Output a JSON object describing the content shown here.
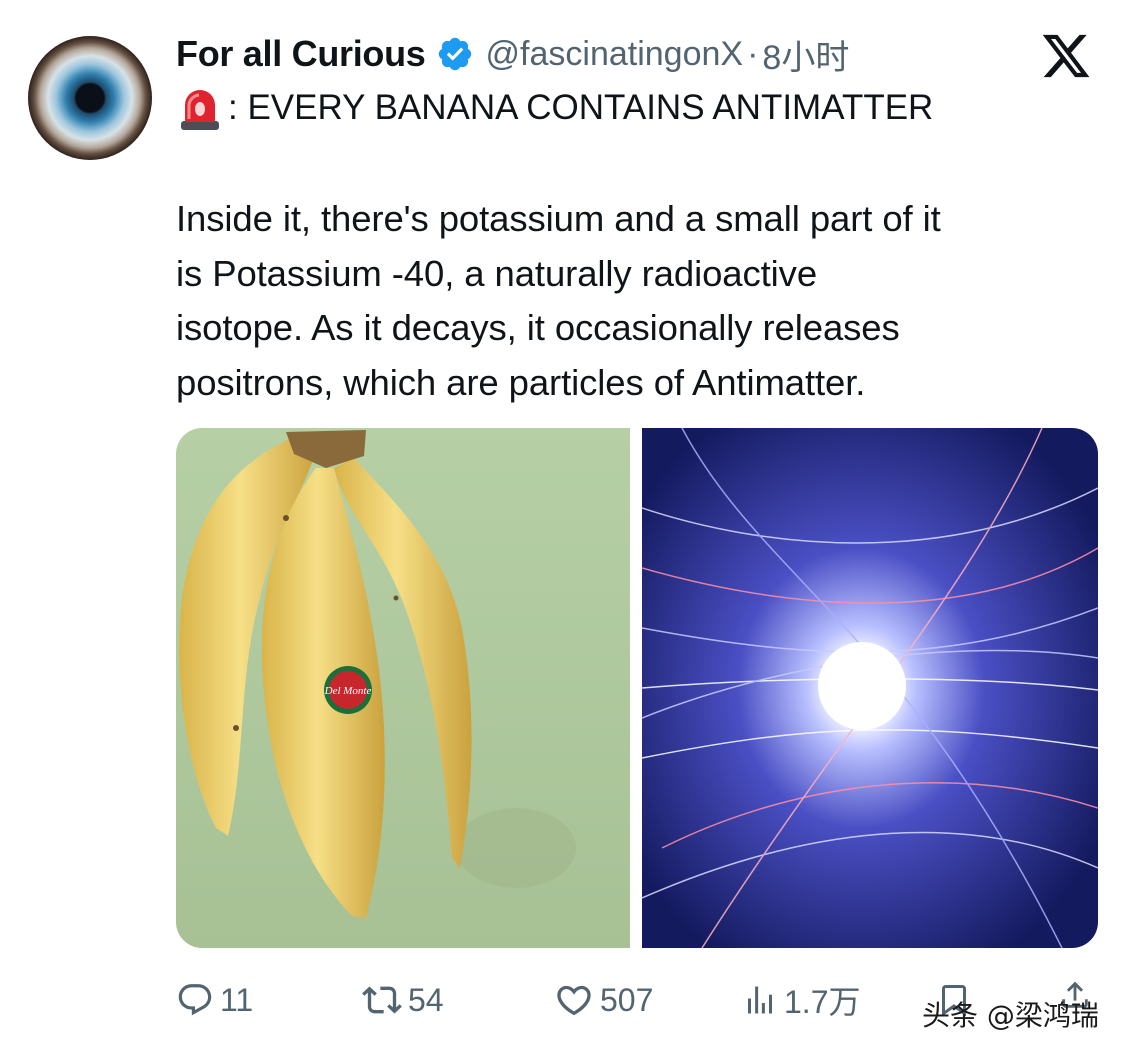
{
  "tweet": {
    "author_name": "For all Curious",
    "handle": "@fascinatingonX",
    "separator": "·",
    "time": "8小时",
    "headline": ": EVERY BANANA CONTAINS ANTIMATTER",
    "body": "Inside it, there's potassium and a small part of it\nis Potassium -40, a naturally radioactive\nisotope. As it decays, it occasionally releases\npositrons, which are particles of Antimatter.",
    "banana_sticker_text": "Del Monte"
  },
  "icons": {
    "avatar": "eye-avatar",
    "verified": "verified-badge-icon",
    "brand": "x-logo-icon",
    "siren": "siren-emoji-icon",
    "reply": "reply-icon",
    "retweet": "retweet-icon",
    "like": "like-icon",
    "views": "views-icon",
    "bookmark": "bookmark-icon",
    "share": "share-icon"
  },
  "actions": {
    "replies": "11",
    "retweets": "54",
    "likes": "507",
    "views": "1.7万"
  },
  "watermark": "头条 @梁鸿瑞",
  "colors": {
    "text": "#0f1419",
    "secondary": "#536471",
    "verified": "#1d9bf0",
    "banana_background": "#a9c49a",
    "space_background": "#1a1f6e"
  }
}
